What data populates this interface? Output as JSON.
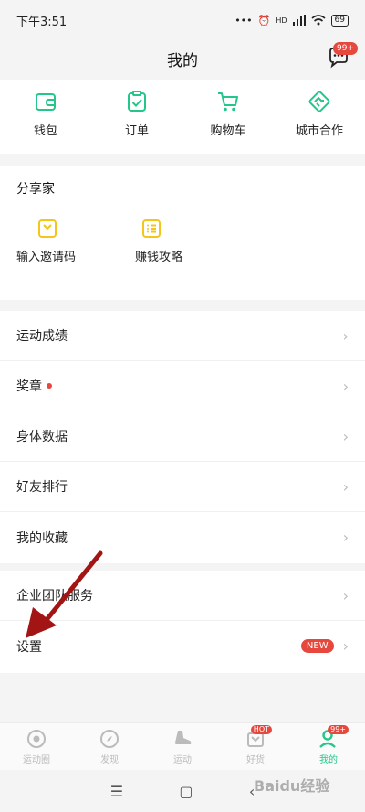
{
  "status": {
    "time": "下午3:51",
    "battery": "69",
    "hd": "HD"
  },
  "header": {
    "title": "我的",
    "msg_badge": "99+"
  },
  "quick_actions": [
    {
      "label": "钱包",
      "icon": "wallet-icon"
    },
    {
      "label": "订单",
      "icon": "order-icon"
    },
    {
      "label": "购物车",
      "icon": "cart-icon"
    },
    {
      "label": "城市合作",
      "icon": "handshake-icon"
    }
  ],
  "share": {
    "title": "分享家",
    "items": [
      {
        "label": "输入邀请码",
        "icon": "invite-icon"
      },
      {
        "label": "赚钱攻略",
        "icon": "guide-icon"
      }
    ]
  },
  "menu": [
    {
      "label": "运动成绩"
    },
    {
      "label": "奖章"
    },
    {
      "label": "身体数据"
    },
    {
      "label": "好友排行"
    },
    {
      "label": "我的收藏"
    }
  ],
  "menu2": [
    {
      "label": "企业团队服务"
    },
    {
      "label": "设置",
      "badge": "NEW"
    }
  ],
  "tabs": [
    {
      "label": "运动圈"
    },
    {
      "label": "发现"
    },
    {
      "label": "运动"
    },
    {
      "label": "好货",
      "badge": "HOT"
    },
    {
      "label": "我的",
      "badge": "99+"
    }
  ],
  "watermark": "Baidu经验",
  "colors": {
    "accent": "#24c789",
    "badge": "#e6483d",
    "share_icon": "#f5c518"
  }
}
